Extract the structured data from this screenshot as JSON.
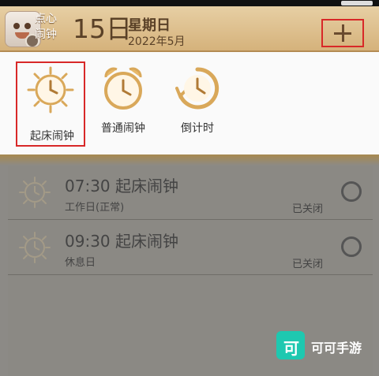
{
  "app": {
    "name_line1": "点心",
    "name_line2": "闹钟"
  },
  "header": {
    "day": "15日",
    "weekday": "星期日",
    "year_month": "2022年5月"
  },
  "add_button": {
    "icon": "plus-icon"
  },
  "alarm_type_menu": {
    "options": [
      {
        "label": "起床闹钟",
        "icon": "sun-clock-icon",
        "selected": true
      },
      {
        "label": "普通闹钟",
        "icon": "alarm-clock-icon",
        "selected": false
      },
      {
        "label": "倒计时",
        "icon": "countdown-icon",
        "selected": false
      }
    ]
  },
  "alarms": [
    {
      "time": "07:30",
      "name": "起床闹钟",
      "repeat": "工作日(正常)",
      "status": "已关闭"
    },
    {
      "time": "09:30",
      "name": "起床闹钟",
      "repeat": "休息日",
      "status": "已关闭"
    }
  ],
  "watermark": {
    "logo_char": "可",
    "text": "可可手游"
  },
  "colors": {
    "highlight": "#d82828",
    "header": "#d5b27b",
    "icon_gold": "#d9a85a"
  }
}
